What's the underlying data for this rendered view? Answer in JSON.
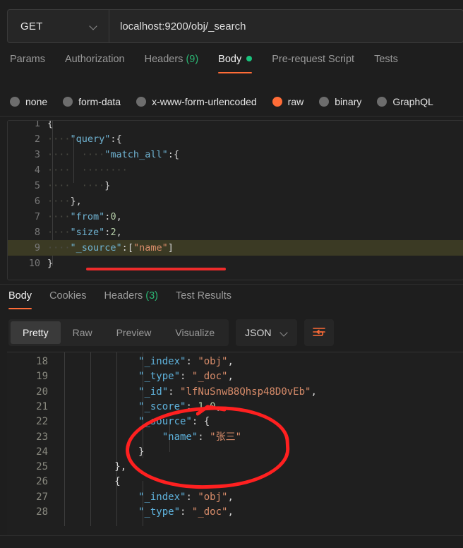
{
  "request": {
    "method": "GET",
    "url": "localhost:9200/obj/_search",
    "tabs": [
      {
        "label": "Params",
        "active": false,
        "count": null,
        "dot": false
      },
      {
        "label": "Authorization",
        "active": false,
        "count": null,
        "dot": false
      },
      {
        "label": "Headers",
        "active": false,
        "count": "(9)",
        "dot": false
      },
      {
        "label": "Body",
        "active": true,
        "count": null,
        "dot": true
      },
      {
        "label": "Pre-request Script",
        "active": false,
        "count": null,
        "dot": false
      },
      {
        "label": "Tests",
        "active": false,
        "count": null,
        "dot": false
      }
    ],
    "body_types": [
      {
        "label": "none",
        "selected": false
      },
      {
        "label": "form-data",
        "selected": false
      },
      {
        "label": "x-www-form-urlencoded",
        "selected": false
      },
      {
        "label": "raw",
        "selected": true
      },
      {
        "label": "binary",
        "selected": false
      },
      {
        "label": "GraphQL",
        "selected": false
      }
    ],
    "editor_lines": [
      {
        "num": "1",
        "text": "{",
        "highlight": false
      },
      {
        "num": "2",
        "text": "····\"query\":{",
        "highlight": false
      },
      {
        "num": "3",
        "text": "····  ····\"match_all\":{",
        "highlight": false
      },
      {
        "num": "4",
        "text": "····  ········",
        "highlight": false
      },
      {
        "num": "5",
        "text": "····  ····}",
        "highlight": false
      },
      {
        "num": "6",
        "text": "····},",
        "highlight": false
      },
      {
        "num": "7",
        "text": "····\"from\":0,",
        "highlight": false
      },
      {
        "num": "8",
        "text": "····\"size\":2,",
        "highlight": false
      },
      {
        "num": "9",
        "text": "····\"_source\":[\"name\"]",
        "highlight": true
      },
      {
        "num": "10",
        "text": "}",
        "highlight": false
      }
    ]
  },
  "response": {
    "tabs": [
      {
        "label": "Body",
        "active": true,
        "count": null
      },
      {
        "label": "Cookies",
        "active": false,
        "count": null
      },
      {
        "label": "Headers",
        "active": false,
        "count": "(3)"
      },
      {
        "label": "Test Results",
        "active": false,
        "count": null
      }
    ],
    "view_modes": [
      {
        "label": "Pretty",
        "active": true
      },
      {
        "label": "Raw",
        "active": false
      },
      {
        "label": "Preview",
        "active": false
      },
      {
        "label": "Visualize",
        "active": false
      }
    ],
    "format": "JSON",
    "wrap_icon": "wrap-lines-icon",
    "body_lines": [
      {
        "num": "18",
        "indent": 7,
        "key": "\"_index\"",
        "sep": ": ",
        "val": "\"obj\"",
        "val_type": "string",
        "tail": ","
      },
      {
        "num": "19",
        "indent": 7,
        "key": "\"_type\"",
        "sep": ": ",
        "val": "\"_doc\"",
        "val_type": "string",
        "tail": ","
      },
      {
        "num": "20",
        "indent": 7,
        "key": "\"_id\"",
        "sep": ": ",
        "val": "\"lfNuSnwB8Qhsp48D0vEb\"",
        "val_type": "string",
        "tail": ","
      },
      {
        "num": "21",
        "indent": 7,
        "key": "\"_score\"",
        "sep": ": ",
        "val": "1.0",
        "val_type": "number",
        "tail": ","
      },
      {
        "num": "22",
        "indent": 7,
        "key": "\"_source\"",
        "sep": ": ",
        "val": "{",
        "val_type": "punct",
        "tail": ""
      },
      {
        "num": "23",
        "indent": 9,
        "key": "\"name\"",
        "sep": ": ",
        "val": "\"张三\"",
        "val_type": "string",
        "tail": ""
      },
      {
        "num": "24",
        "indent": 7,
        "key": "",
        "sep": "",
        "val": "}",
        "val_type": "punct",
        "tail": ""
      },
      {
        "num": "25",
        "indent": 5,
        "key": "",
        "sep": "",
        "val": "}",
        "val_type": "punct",
        "tail": ","
      },
      {
        "num": "26",
        "indent": 5,
        "key": "",
        "sep": "",
        "val": "{",
        "val_type": "punct",
        "tail": ""
      },
      {
        "num": "27",
        "indent": 7,
        "key": "\"_index\"",
        "sep": ": ",
        "val": "\"obj\"",
        "val_type": "string",
        "tail": ","
      },
      {
        "num": "28",
        "indent": 7,
        "key": "\"_type\"",
        "sep": ": ",
        "val": "\"_doc\"",
        "val_type": "string",
        "tail": ","
      }
    ]
  },
  "annotations": {
    "underline": "red-underline-annotation",
    "ellipse": "red-ellipse-annotation",
    "tick": "red-tick-annotation"
  },
  "colors": {
    "accent": "#ff6c37",
    "success": "#2bb673",
    "annotation": "#ff2020",
    "background": "#1e1e1e"
  }
}
